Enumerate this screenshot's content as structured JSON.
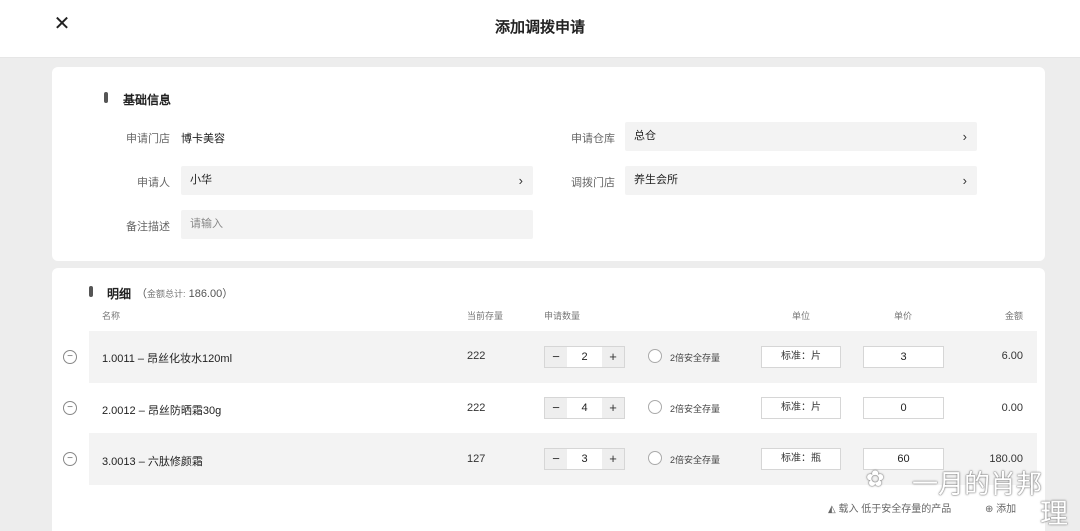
{
  "header": {
    "title": "添加调拨申请",
    "close_icon": "close-icon"
  },
  "basic": {
    "section_title": "基础信息",
    "store_label": "申请门店",
    "store_value": "博卡美容",
    "warehouse_label": "申请仓库",
    "warehouse_value": "总仓",
    "applicant_label": "申请人",
    "applicant_value": "小华",
    "transfer_store_label": "调拨门店",
    "transfer_store_value": "养生会所",
    "remark_label": "备注描述",
    "remark_placeholder": "请输入",
    "chevron": "›"
  },
  "detail": {
    "section_title": "明细",
    "total_prefix": "（",
    "total_label": "金额总计:",
    "total_value": "186.00）",
    "columns": {
      "name": "名称",
      "stock": "当前存量",
      "qty": "申请数量",
      "unit": "单位",
      "price": "单价",
      "amount": "金额"
    },
    "safety_label": "2倍安全存量",
    "rows": [
      {
        "name": "1.0011 – 昂丝化妆水120ml",
        "stock": "222",
        "qty": "2",
        "unit": "标准：片",
        "price": "3",
        "amount": "6.00"
      },
      {
        "name": "2.0012 – 昂丝防晒霜30g",
        "stock": "222",
        "qty": "4",
        "unit": "标准：片",
        "price": "0",
        "amount": "0.00"
      },
      {
        "name": "3.0013 – 六肽修颜霜",
        "stock": "127",
        "qty": "3",
        "unit": "标准：瓶",
        "price": "60",
        "amount": "180.00"
      }
    ]
  },
  "footer": {
    "import_label": "载入",
    "import_text": "低于安全存量的产品",
    "add_label": "添加"
  },
  "watermark": {
    "text": "一月的肖邦",
    "char": "理"
  }
}
